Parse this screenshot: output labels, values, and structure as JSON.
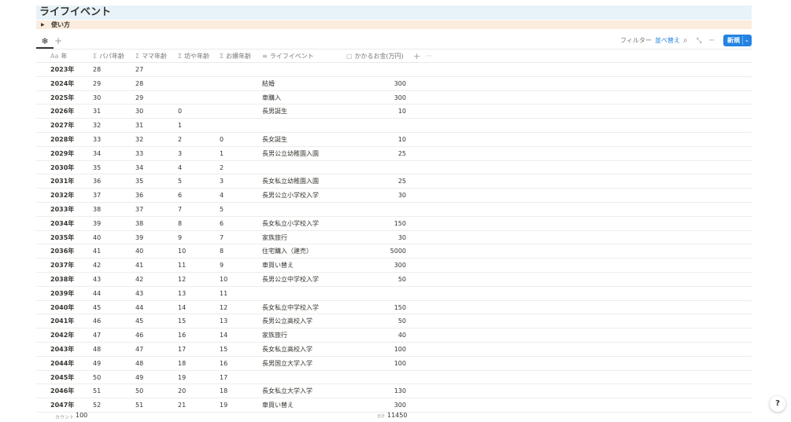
{
  "page": {
    "title": "ライフイベント"
  },
  "toggle": {
    "label": "使い方"
  },
  "view": {
    "icon": "asterisk-icon",
    "add_label": "+"
  },
  "toolbar": {
    "filter_label": "フィルター",
    "sort_label": "並べ替え",
    "new_label": "新規",
    "search_icon": "search-icon",
    "expand_icon": "expand-icon",
    "more_icon": "more-icon"
  },
  "columns": {
    "year": {
      "icon": "Aa",
      "label": "年"
    },
    "papa": {
      "icon": "Σ",
      "label": "パパ年齢"
    },
    "mama": {
      "icon": "Σ",
      "label": "ママ年齢"
    },
    "bou": {
      "icon": "Σ",
      "label": "坊や年齢"
    },
    "ojo": {
      "icon": "Σ",
      "label": "お嬢年齢"
    },
    "event": {
      "icon": "≡",
      "label": "ライフイベント"
    },
    "cost": {
      "icon": "▢",
      "label": "かかるお金(万円)"
    },
    "add_label": "+",
    "more_label": "···"
  },
  "rows": [
    [
      "2023年",
      "28",
      "27",
      "",
      "",
      "",
      ""
    ],
    [
      "2024年",
      "29",
      "28",
      "",
      "",
      "結婚",
      "300"
    ],
    [
      "2025年",
      "30",
      "29",
      "",
      "",
      "車購入",
      "300"
    ],
    [
      "2026年",
      "31",
      "30",
      "0",
      "",
      "長男誕生",
      "10"
    ],
    [
      "2027年",
      "32",
      "31",
      "1",
      "",
      "",
      ""
    ],
    [
      "2028年",
      "33",
      "32",
      "2",
      "0",
      "長女誕生",
      "10"
    ],
    [
      "2029年",
      "34",
      "33",
      "3",
      "1",
      "長男公立幼稚園入園",
      "25"
    ],
    [
      "2030年",
      "35",
      "34",
      "4",
      "2",
      "",
      ""
    ],
    [
      "2031年",
      "36",
      "35",
      "5",
      "3",
      "長女私立幼稚園入園",
      "25"
    ],
    [
      "2032年",
      "37",
      "36",
      "6",
      "4",
      "長男公立小学校入学",
      "30"
    ],
    [
      "2033年",
      "38",
      "37",
      "7",
      "5",
      "",
      ""
    ],
    [
      "2034年",
      "39",
      "38",
      "8",
      "6",
      "長女私立小学校入学",
      "150"
    ],
    [
      "2035年",
      "40",
      "39",
      "9",
      "7",
      "家族旅行",
      "30"
    ],
    [
      "2036年",
      "41",
      "40",
      "10",
      "8",
      "住宅購入（建売）",
      "5000"
    ],
    [
      "2037年",
      "42",
      "41",
      "11",
      "9",
      "車買い替え",
      "300"
    ],
    [
      "2038年",
      "43",
      "42",
      "12",
      "10",
      "長男公立中学校入学",
      "50"
    ],
    [
      "2039年",
      "44",
      "43",
      "13",
      "11",
      "",
      ""
    ],
    [
      "2040年",
      "45",
      "44",
      "14",
      "12",
      "長女私立中学校入学",
      "150"
    ],
    [
      "2041年",
      "46",
      "45",
      "15",
      "13",
      "長男公立高校入学",
      "50"
    ],
    [
      "2042年",
      "47",
      "46",
      "16",
      "14",
      "家族旅行",
      "40"
    ],
    [
      "2043年",
      "48",
      "47",
      "17",
      "15",
      "長女私立高校入学",
      "100"
    ],
    [
      "2044年",
      "49",
      "48",
      "18",
      "16",
      "長男国立大学入学",
      "100"
    ],
    [
      "2045年",
      "50",
      "49",
      "19",
      "17",
      "",
      ""
    ],
    [
      "2046年",
      "51",
      "50",
      "20",
      "18",
      "長女私立大学入学",
      "130"
    ],
    [
      "2047年",
      "52",
      "51",
      "21",
      "19",
      "車買い替え",
      "300"
    ]
  ],
  "footer": {
    "count_label": "カウント",
    "count_value": "100",
    "sum_label": "合計",
    "sum_value": "11450"
  },
  "help": {
    "label": "?"
  }
}
